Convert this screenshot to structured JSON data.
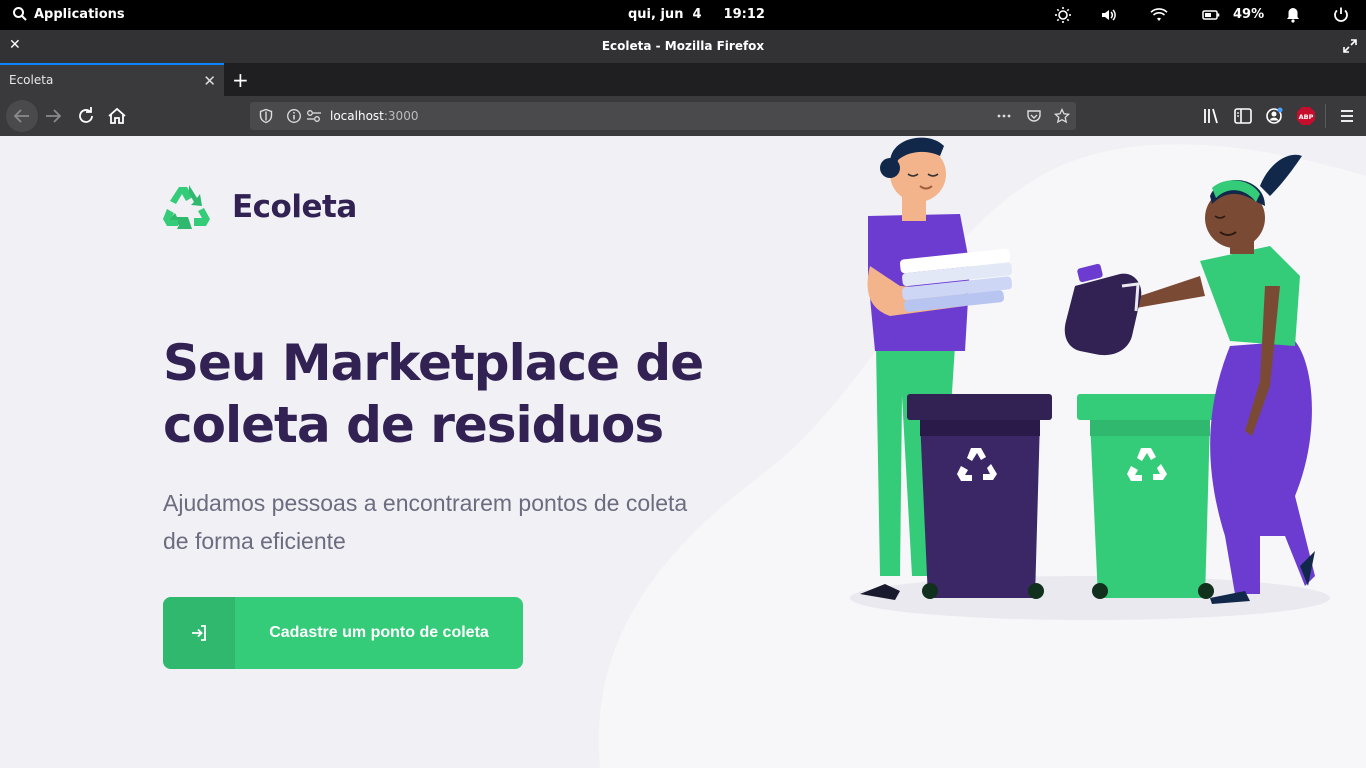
{
  "system_bar": {
    "applications_label": "Applications",
    "date": "qui, jun  4",
    "time": "19:12",
    "battery": "49%"
  },
  "window": {
    "title": "Ecoleta - Mozilla Firefox"
  },
  "tabs": [
    {
      "label": "Ecoleta",
      "active": true
    }
  ],
  "urlbar": {
    "host": "localhost",
    "port": ":3000"
  },
  "page": {
    "logo_text": "Ecoleta",
    "headline_line1": "Seu Marketplace de",
    "headline_line2": "coleta de residuos",
    "subhead_line1": "Ajudamos pessoas a encontrarem pontos de coleta",
    "subhead_line2": "de forma eficiente",
    "cta_label": "Cadastre um ponto de coleta"
  },
  "colors": {
    "brand_green": "#34cb79",
    "brand_purple": "#322153",
    "text_muted": "#6c6c80",
    "page_bg": "#f0f0f5"
  },
  "icons": [
    "search-icon",
    "brightness-icon",
    "volume-icon",
    "wifi-icon",
    "battery-icon",
    "bell-icon",
    "power-icon",
    "close-icon",
    "restore-icon",
    "back-icon",
    "forward-icon",
    "reload-icon",
    "home-icon",
    "shield-icon",
    "info-icon",
    "permissions-icon",
    "more-icon",
    "pocket-icon",
    "star-icon",
    "library-icon",
    "sidebar-icon",
    "account-icon",
    "abp-icon",
    "menu-icon",
    "recycle-icon",
    "login-icon"
  ]
}
